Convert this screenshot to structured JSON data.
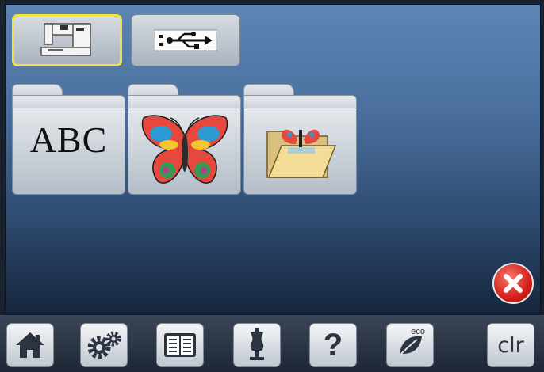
{
  "sources": [
    {
      "name": "machine-memory",
      "icon": "sewing-machine-icon",
      "selected": true
    },
    {
      "name": "usb-stick",
      "icon": "usb-icon",
      "selected": false
    }
  ],
  "folders": [
    {
      "name": "alphabets",
      "label": "ABC"
    },
    {
      "name": "embroidery-designs",
      "icon": "butterfly-design-icon"
    },
    {
      "name": "my-designs",
      "icon": "open-folder-icon"
    }
  ],
  "close": {
    "icon": "close-icon",
    "color": "#d3201a"
  },
  "toolbar": {
    "buttons": [
      {
        "name": "home",
        "icon": "home-icon"
      },
      {
        "name": "setup",
        "icon": "gears-icon"
      },
      {
        "name": "tutorial",
        "icon": "book-icon"
      },
      {
        "name": "consultant",
        "icon": "dress-form-icon"
      },
      {
        "name": "help",
        "label": "?"
      },
      {
        "name": "eco",
        "label": "eco",
        "icon": "leaf-icon"
      },
      {
        "name": "clear",
        "label": "clr"
      }
    ]
  },
  "colors": {
    "selection": "#f2e23a",
    "screen_top": "#5d86b5",
    "screen_bottom": "#15253b"
  }
}
